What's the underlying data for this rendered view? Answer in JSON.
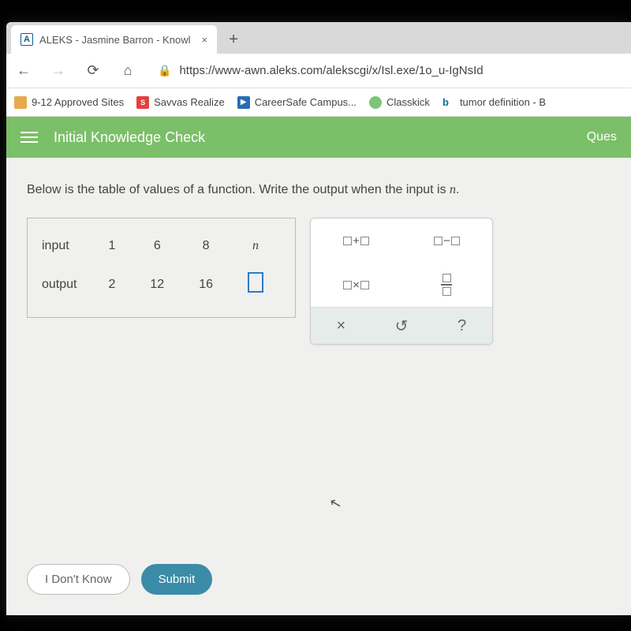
{
  "browser": {
    "tab_favicon_letter": "A",
    "tab_title": "ALEKS - Jasmine Barron - Knowl",
    "tab_close": "×",
    "new_tab": "+",
    "url": "https://www-awn.aleks.com/alekscgi/x/Isl.exe/1o_u-IgNsId"
  },
  "bookmarks": [
    {
      "label": "9-12 Approved Sites"
    },
    {
      "label": "Savvas Realize"
    },
    {
      "label": "CareerSafe Campus..."
    },
    {
      "label": "Classkick"
    },
    {
      "label": "tumor definition - B"
    }
  ],
  "page": {
    "title": "Initial Knowledge Check",
    "right_text": "Ques",
    "question_prefix": "Below is the table of values of a function. Write the output when the input is ",
    "question_var": "n",
    "question_suffix": ".",
    "table": {
      "row1_label": "input",
      "row2_label": "output",
      "inputs": [
        "1",
        "6",
        "8"
      ],
      "input_var": "n",
      "outputs": [
        "2",
        "12",
        "16"
      ]
    },
    "tools": {
      "plus": "+",
      "minus": "−",
      "times": "×",
      "clear": "×",
      "undo": "↺",
      "help": "?"
    },
    "buttons": {
      "idk": "I Don't Know",
      "submit": "Submit"
    }
  }
}
